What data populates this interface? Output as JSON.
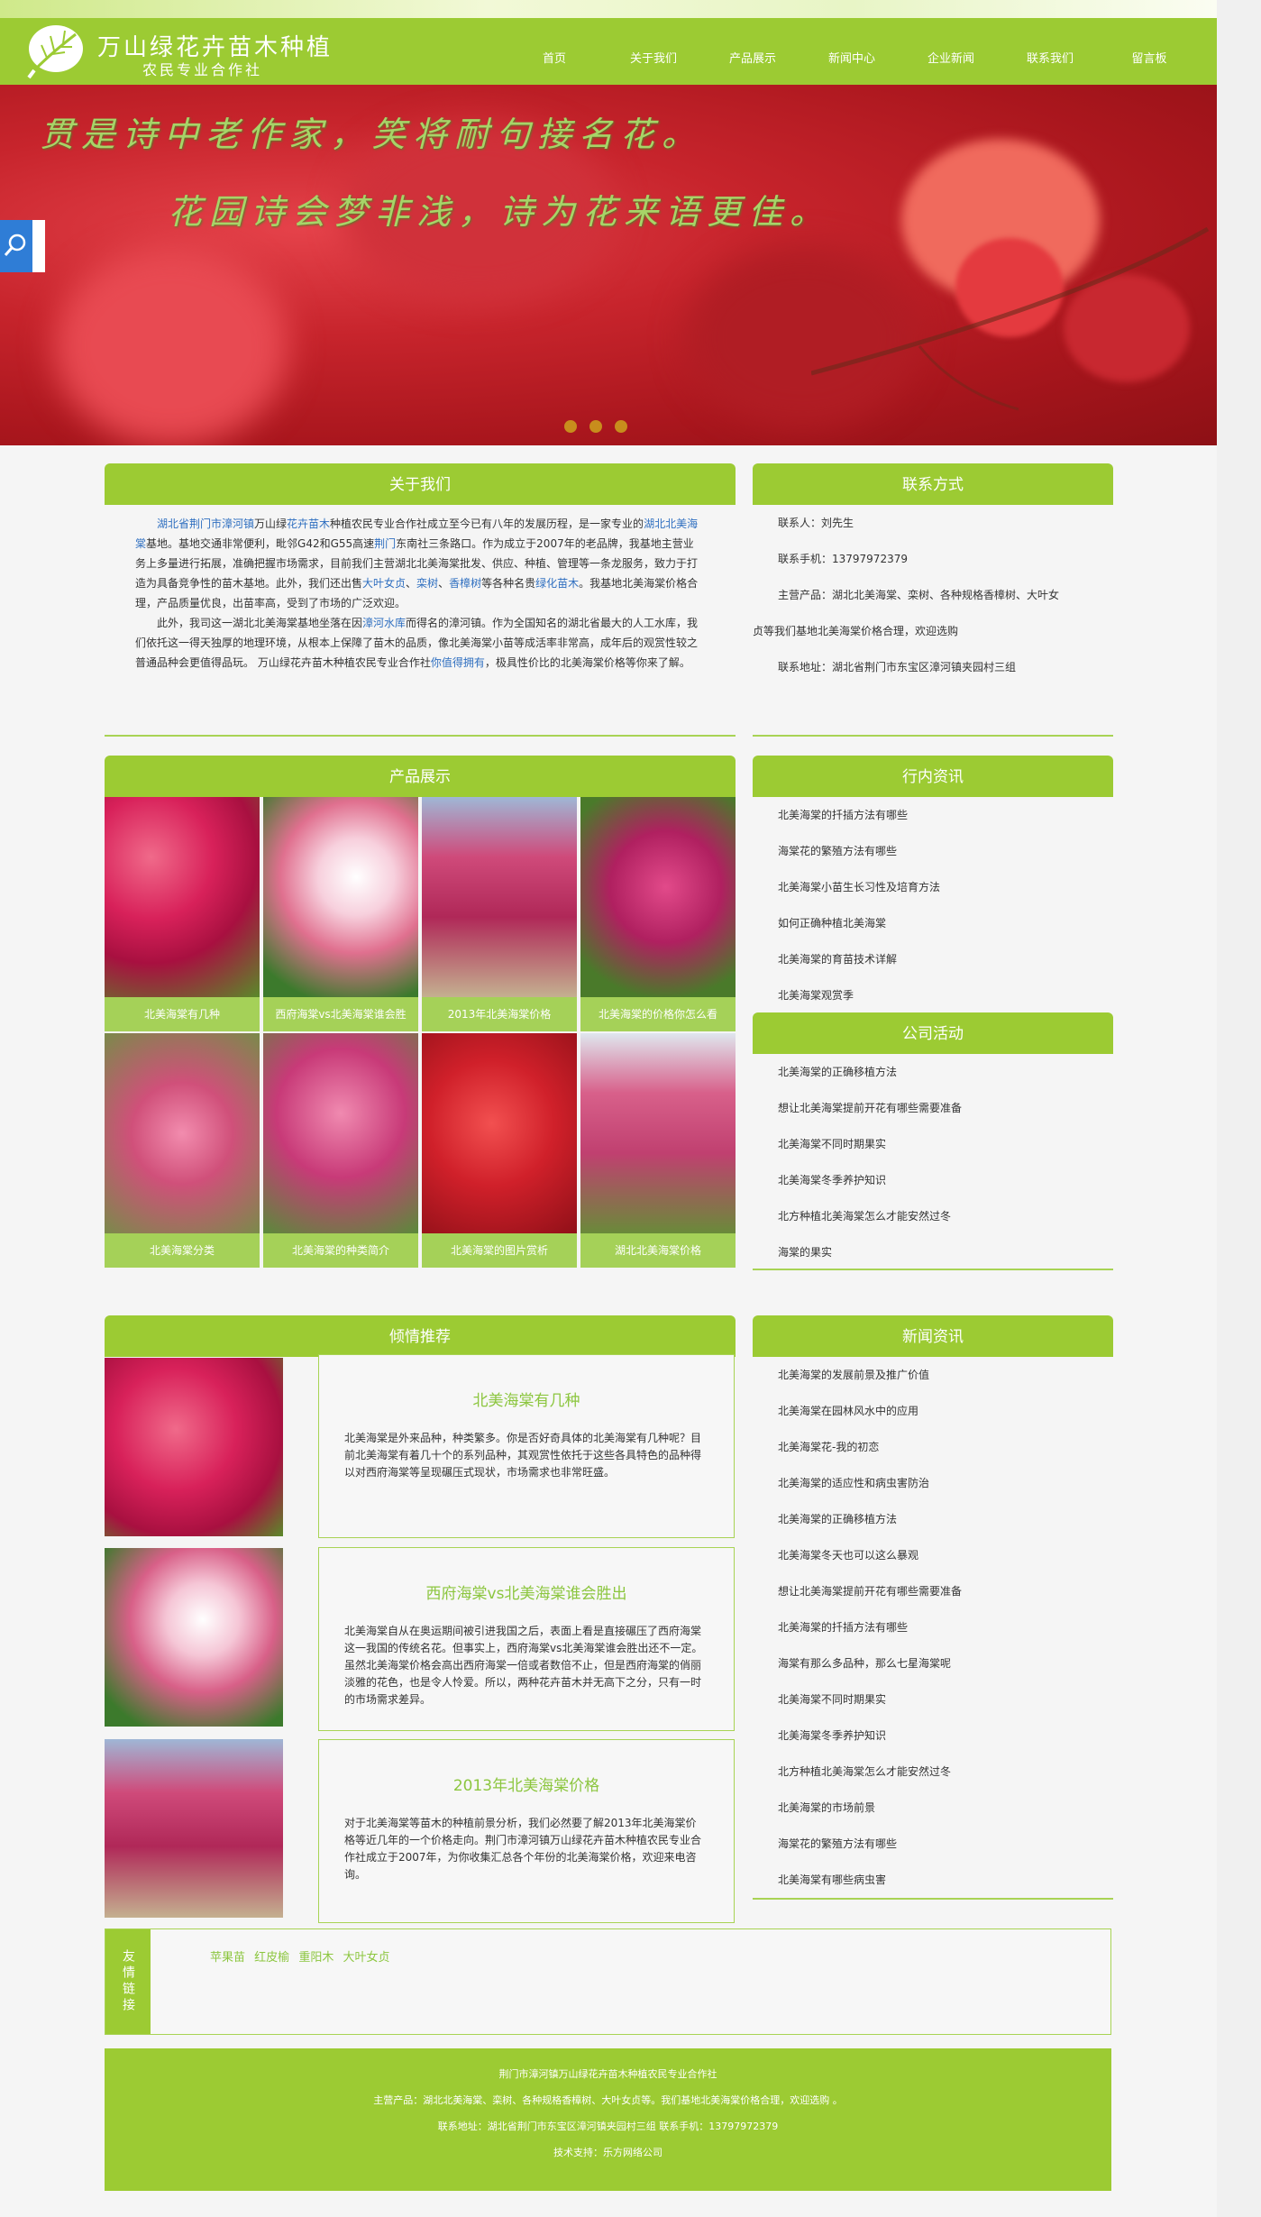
{
  "header": {
    "title": "万山绿花卉苗木种植",
    "subtitle": "农民专业合作社",
    "nav": [
      "首页",
      "关于我们",
      "产品展示",
      "新闻中心",
      "企业新闻",
      "联系我们",
      "留言板"
    ]
  },
  "banner": {
    "line1": "贯是诗中老作家，笑将耐句接名花。",
    "line2": "花园诗会梦非浅，诗为花来语更佳。",
    "slides": 3
  },
  "about": {
    "heading": "关于我们",
    "p1": {
      "l1": "湖北省荆门市漳河镇",
      "t1": "万山绿",
      "l2": "花卉苗木",
      "t2": "种植农民专业合作社成立至今已有八年的发展历程，是一家专业的",
      "l3": "湖北北美海棠",
      "t3": "基地。基地交通非常便利，毗邻G42和G55高速",
      "l4": "荆门",
      "t4": "东南社三条路口。作为成立于2007年的老品牌，我基地主营业务上多量进行拓展，准确把握市场需求，目前我们主营湖北北美海棠批发、供应、种植、管理等一条龙服务，致力于打造为具备竞争性的苗木基地。此外，我们还出售",
      "l5": "大叶女贞",
      "t5": "、",
      "l6": "栾树",
      "t6": "、",
      "l7": "香樟树",
      "t7": "等各种名贵",
      "l8": "绿化苗木",
      "t8": "。我基地北美海棠价格合理，产品质量优良，出苗率高，受到了市场的广泛欢迎。"
    },
    "p2": {
      "t1": "此外，我司这一湖北北美海棠基地坐落在因",
      "l1": "漳河水库",
      "t2": "而得名的漳河镇。作为全国知名的湖北省最大的人工水库，我们依托这一得天独厚的地理环境，从根本上保障了苗木的品质，像北美海棠小苗等成活率非常高，成年后的观赏性较之普通品种会更值得品玩。 万山绿花卉苗木种植农民专业合作社",
      "l2": "你值得拥有",
      "t3": "，极具性价比的北美海棠价格等你来了解。"
    }
  },
  "contact": {
    "heading": "联系方式",
    "person": "联系人：刘先生",
    "phone": "联系手机：13797972379",
    "products_line1": "主营产品：湖北北美海棠、栾树、各种规格香樟树、大叶女",
    "products_line2": "贞等我们基地北美海棠价格合理，欢迎选购",
    "address": "联系地址：湖北省荆门市东宝区漳河镇夹园村三组"
  },
  "products": {
    "heading": "产品展示",
    "items": [
      "北美海棠有几种",
      "西府海棠vs北美海棠谁会胜",
      "2013年北美海棠价格",
      "北美海棠的价格你怎么看",
      "北美海棠分类",
      "北美海棠的种类简介",
      "北美海棠的图片赏析",
      "湖北北美海棠价格"
    ]
  },
  "industry": {
    "heading": "行内资讯",
    "items": [
      "北美海棠的扦插方法有哪些",
      "海棠花的繁殖方法有哪些",
      "北美海棠小苗生长习性及培育方法",
      "如何正确种植北美海棠",
      "北美海棠的育苗技术详解",
      "北美海棠观赏季"
    ]
  },
  "activities": {
    "heading": "公司活动",
    "items": [
      "北美海棠的正确移植方法",
      "想让北美海棠提前开花有哪些需要准备",
      "北美海棠不同时期果实",
      "北美海棠冬季养护知识",
      "北方种植北美海棠怎么才能安然过冬",
      "海棠的果实"
    ]
  },
  "recommend": {
    "heading": "倾情推荐",
    "items": [
      {
        "title": "北美海棠有几种",
        "text": "北美海棠是外来品种，种类繁多。你是否好奇具体的北美海棠有几种呢？目前北美海棠有着几十个的系列品种，其观赏性依托于这些各具特色的品种得以对西府海棠等呈现碾压式现状，市场需求也非常旺盛。"
      },
      {
        "title": "西府海棠vs北美海棠谁会胜出",
        "text": "北美海棠自从在奥运期间被引进我国之后，表面上看是直接碾压了西府海棠这一我国的传统名花。但事实上，西府海棠vs北美海棠谁会胜出还不一定。虽然北美海棠价格会高出西府海棠一倍或者数倍不止，但是西府海棠的俏丽淡雅的花色，也是令人怜爱。所以，两种花卉苗木并无高下之分，只有一时的市场需求差异。"
      },
      {
        "title": "2013年北美海棠价格",
        "text": "对于北美海棠等苗木的种植前景分析，我们必然要了解2013年北美海棠价格等近几年的一个价格走向。荆门市漳河镇万山绿花卉苗木种植农民专业合作社成立于2007年，为你收集汇总各个年份的北美海棠价格，欢迎来电咨询。"
      }
    ]
  },
  "news": {
    "heading": "新闻资讯",
    "items": [
      "北美海棠的发展前景及推广价值",
      "北美海棠在园林风水中的应用",
      "北美海棠花-我的初恋",
      "北美海棠的适应性和病虫害防治",
      "北美海棠的正确移植方法",
      "北美海棠冬天也可以这么暴观",
      "想让北美海棠提前开花有哪些需要准备",
      "北美海棠的扦插方法有哪些",
      "海棠有那么多品种，那么七星海棠呢",
      "北美海棠不同时期果实",
      "北美海棠冬季养护知识",
      "北方种植北美海棠怎么才能安然过冬",
      "北美海棠的市场前景",
      "海棠花的繁殖方法有哪些",
      "北美海棠有哪些病虫害"
    ]
  },
  "links": {
    "tag": "友情链接",
    "items": [
      "苹果苗",
      "红皮榆",
      "重阳木",
      "大叶女贞"
    ]
  },
  "footer": {
    "line1": "荆门市漳河镇万山绿花卉苗木种植农民专业合作社",
    "line2": "主营产品：湖北北美海棠、栾树、各种规格香樟树、大叶女贞等。我们基地北美海棠价格合理，欢迎选购 。",
    "line3": "联系地址：湖北省荆门市东宝区漳河镇夹园村三组   联系手机：13797972379",
    "line4": "技术支持：乐方网络公司"
  },
  "colors": {
    "brand": "#9ccb33",
    "accent_light": "#a5d158",
    "link": "#2f6fc0"
  }
}
